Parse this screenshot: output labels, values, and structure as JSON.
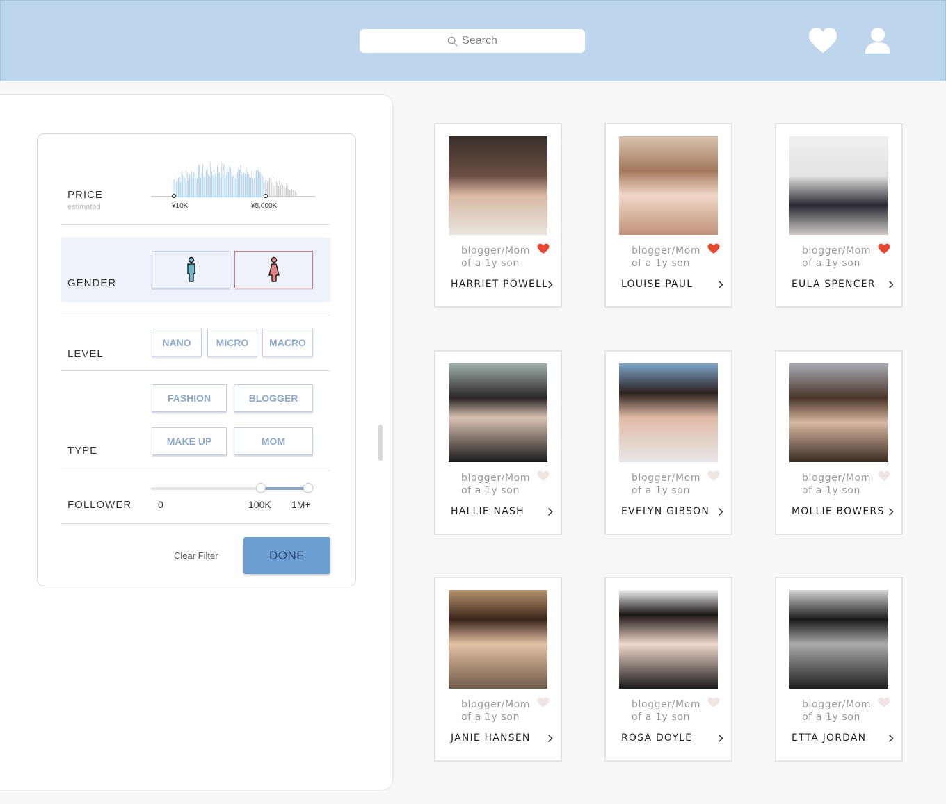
{
  "header": {
    "search_placeholder": "Search",
    "bg_color": "#bed6ec"
  },
  "filters": {
    "price": {
      "label": "PRICE",
      "sublabel": "estimated",
      "ticks": [
        "¥10K",
        "¥5,000K"
      ]
    },
    "gender": {
      "label": "GENDER",
      "options": [
        "male",
        "female"
      ],
      "selected": "female"
    },
    "level": {
      "label": "LEVEL",
      "options": [
        "NANO",
        "MICRO",
        "MACRO"
      ]
    },
    "type": {
      "label": "TYPE",
      "options": [
        "FASHION",
        "BLOGGER",
        "MAKE UP",
        "MOM"
      ]
    },
    "follower": {
      "label": "FOLLOWER",
      "ticks": [
        "0",
        "100K",
        "1M+"
      ]
    },
    "clear_label": "Clear Filter",
    "done_label": "DONE"
  },
  "cards": [
    {
      "desc1": "blogger/Mom",
      "desc2": "of a 1y son",
      "name": "HARRIET POWELL",
      "favorited": true
    },
    {
      "desc1": "blogger/Mom",
      "desc2": "of a 1y son",
      "name": "LOUISE PAUL",
      "favorited": true
    },
    {
      "desc1": "blogger/Mom",
      "desc2": "of a 1y son",
      "name": "EULA SPENCER",
      "favorited": true
    },
    {
      "desc1": "blogger/Mom",
      "desc2": "of a 1y son",
      "name": "HALLIE NASH",
      "favorited": false
    },
    {
      "desc1": "blogger/Mom",
      "desc2": "of a 1y son",
      "name": "EVELYN GIBSON",
      "favorited": false
    },
    {
      "desc1": "blogger/Mom",
      "desc2": "of a 1y son",
      "name": "MOLLIE BOWERS",
      "favorited": false
    },
    {
      "desc1": "blogger/Mom",
      "desc2": "of a 1y son",
      "name": "JANIE HANSEN",
      "favorited": false
    },
    {
      "desc1": "blogger/Mom",
      "desc2": "of a 1y son",
      "name": "ROSA DOYLE",
      "favorited": false
    },
    {
      "desc1": "blogger/Mom",
      "desc2": "of a 1y son",
      "name": "ETTA JORDAN",
      "favorited": false
    }
  ],
  "colors": {
    "accent": "#6b9fd2",
    "heart_active": "#e8472f",
    "heart_inactive": "#f0e4e4"
  }
}
